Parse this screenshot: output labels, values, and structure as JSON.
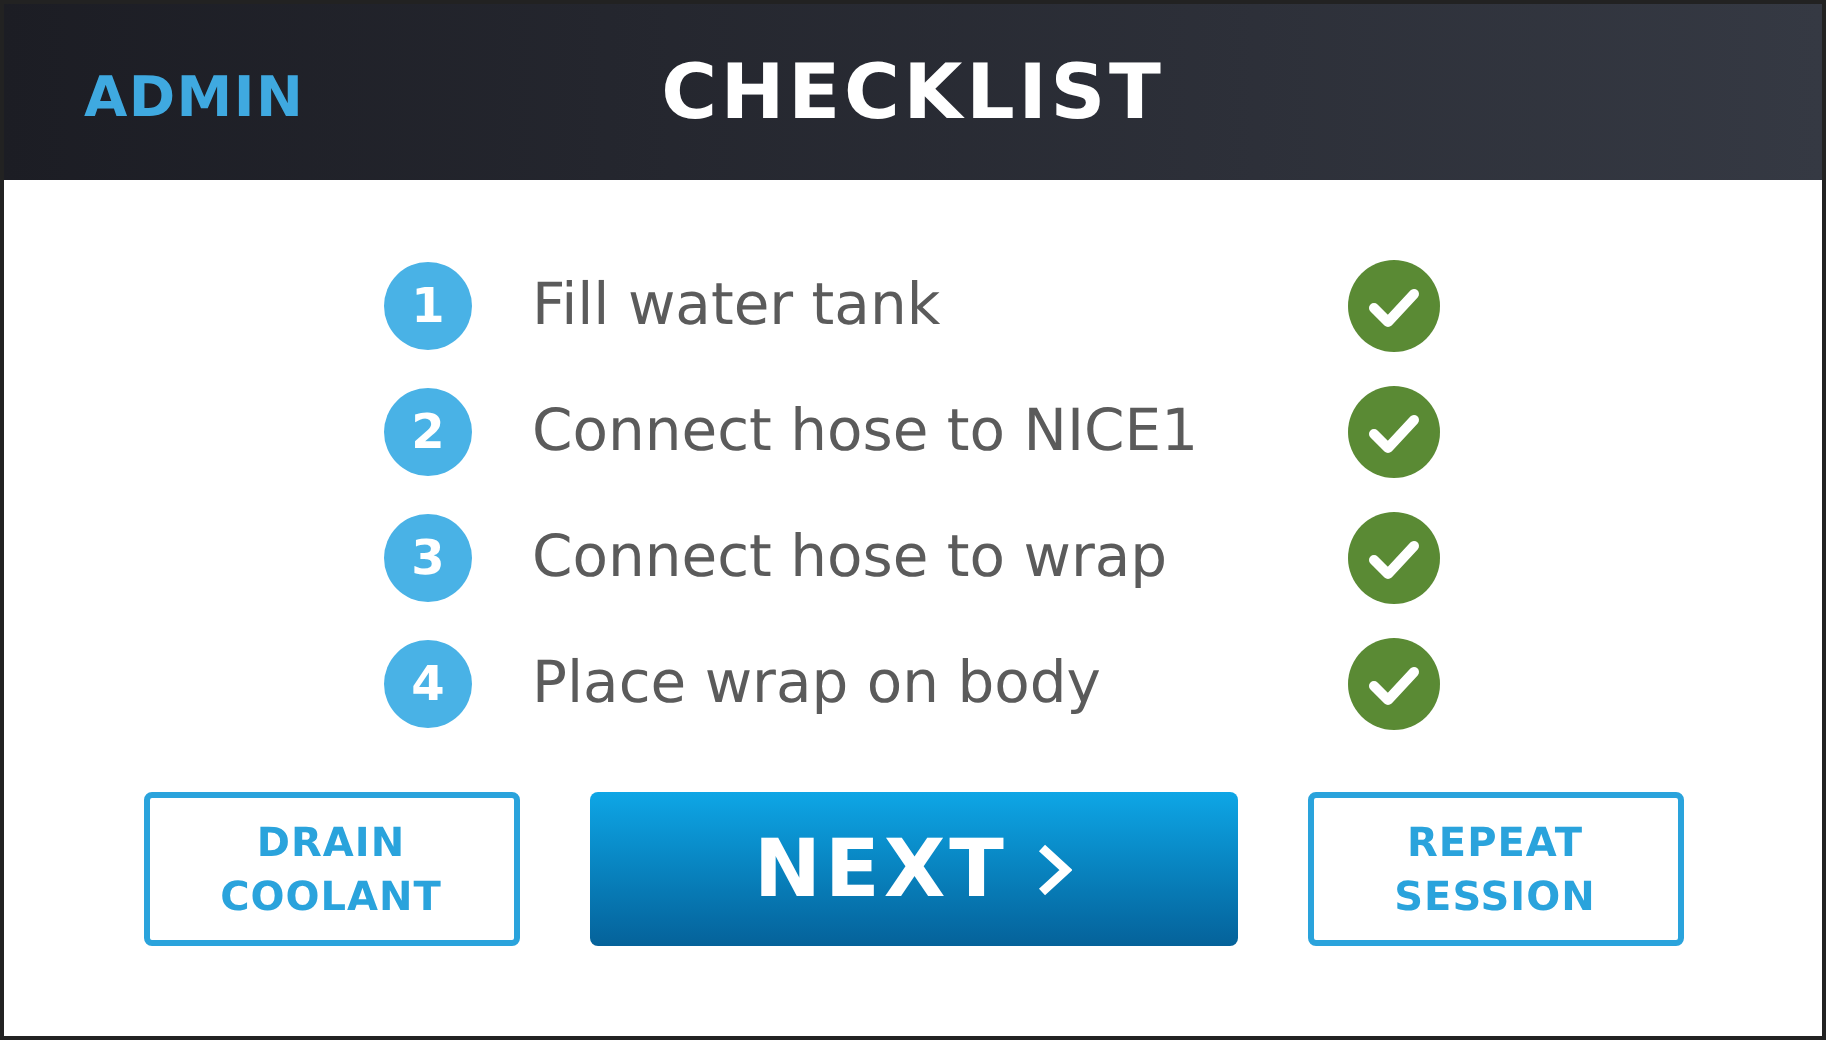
{
  "header": {
    "admin_link": "ADMIN",
    "title": "CHECKLIST"
  },
  "checklist": [
    {
      "number": "1",
      "label": "Fill water tank",
      "done": true
    },
    {
      "number": "2",
      "label": "Connect hose to NICE1",
      "done": true
    },
    {
      "number": "3",
      "label": "Connect hose to wrap",
      "done": true
    },
    {
      "number": "4",
      "label": "Place wrap on body",
      "done": true
    }
  ],
  "buttons": [
    {
      "kind": "outline",
      "label": "DRAIN COOLANT"
    },
    {
      "kind": "primary",
      "label": "NEXT"
    },
    {
      "kind": "outline",
      "label": "REPEAT SESSION"
    }
  ]
}
